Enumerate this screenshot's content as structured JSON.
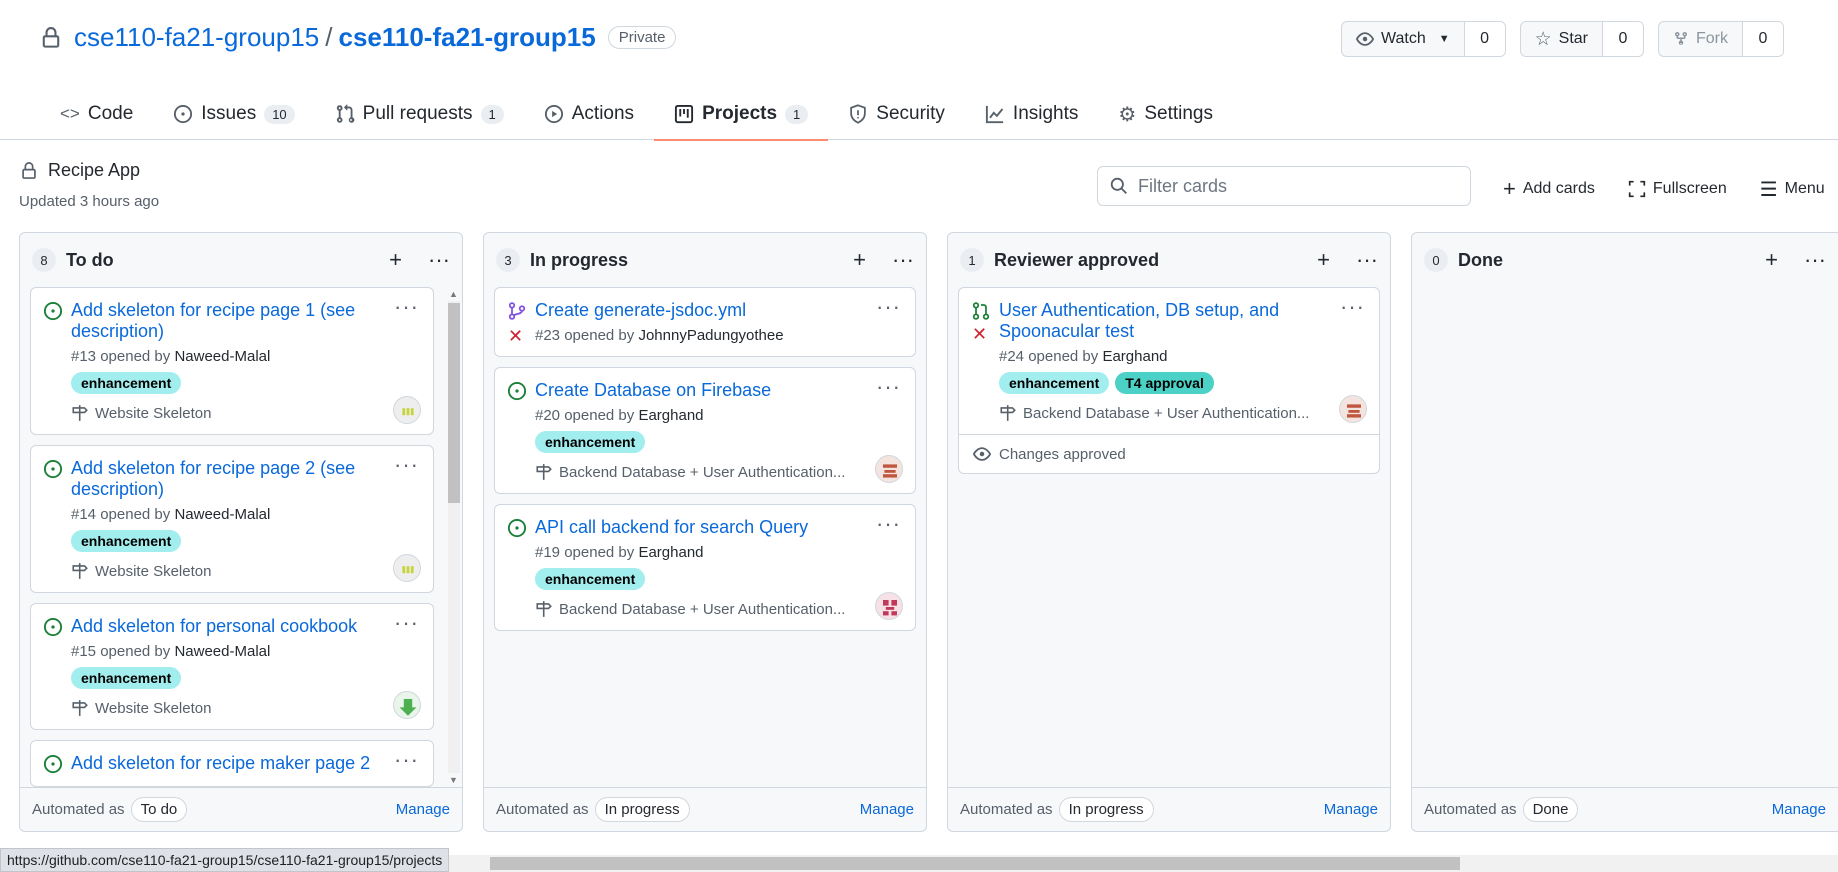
{
  "repo": {
    "owner": "cse110-fa21-group15",
    "separator": "/",
    "name": "cse110-fa21-group15",
    "visibility": "Private"
  },
  "actions": {
    "watch_label": "Watch",
    "watch_count": "0",
    "star_label": "Star",
    "star_count": "0",
    "fork_label": "Fork",
    "fork_count": "0"
  },
  "tabs": [
    {
      "label": "Code",
      "counter": ""
    },
    {
      "label": "Issues",
      "counter": "10"
    },
    {
      "label": "Pull requests",
      "counter": "1"
    },
    {
      "label": "Actions",
      "counter": ""
    },
    {
      "label": "Projects",
      "counter": "1"
    },
    {
      "label": "Security",
      "counter": ""
    },
    {
      "label": "Insights",
      "counter": ""
    },
    {
      "label": "Settings",
      "counter": ""
    }
  ],
  "project": {
    "name": "Recipe App",
    "updated": "Updated 3 hours ago",
    "filter_placeholder": "Filter cards",
    "add_cards": "Add cards",
    "fullscreen": "Fullscreen",
    "menu": "Menu"
  },
  "footer": {
    "automated_as": "Automated as",
    "manage": "Manage"
  },
  "columns": [
    {
      "count": "8",
      "name": "To do",
      "automation": "To do",
      "cards": [
        {
          "title": "Add skeleton for recipe page 1 (see description)",
          "number": "#13",
          "opened_by": "opened by",
          "author": "Naweed-Malal",
          "label": "enhancement",
          "milestone": "Website Skeleton"
        },
        {
          "title": "Add skeleton for recipe page 2 (see description)",
          "number": "#14",
          "opened_by": "opened by",
          "author": "Naweed-Malal",
          "label": "enhancement",
          "milestone": "Website Skeleton"
        },
        {
          "title": "Add skeleton for personal cookbook",
          "number": "#15",
          "opened_by": "opened by",
          "author": "Naweed-Malal",
          "label": "enhancement",
          "milestone": "Website Skeleton"
        },
        {
          "title": "Add skeleton for recipe maker page 2"
        }
      ]
    },
    {
      "count": "3",
      "name": "In progress",
      "automation": "In progress",
      "cards": [
        {
          "title": "Create generate-jsdoc.yml",
          "number": "#23",
          "opened_by": "opened by",
          "author": "JohnnyPadungyothee"
        },
        {
          "title": "Create Database on Firebase",
          "number": "#20",
          "opened_by": "opened by",
          "author": "Earghand",
          "label": "enhancement",
          "milestone": "Backend Database + User Authentication..."
        },
        {
          "title": "API call backend for search Query",
          "number": "#19",
          "opened_by": "opened by",
          "author": "Earghand",
          "label": "enhancement",
          "milestone": "Backend Database + User Authentication..."
        }
      ]
    },
    {
      "count": "1",
      "name": "Reviewer approved",
      "automation": "In progress",
      "cards": [
        {
          "title": "User Authentication, DB setup, and Spoonacular test",
          "number": "#24",
          "opened_by": "opened by",
          "author": "Earghand",
          "label": "enhancement",
          "label2": "T4 approval",
          "milestone": "Backend Database + User Authentication...",
          "review": "Changes approved"
        }
      ]
    },
    {
      "count": "0",
      "name": "Done",
      "automation": "Done",
      "cards": []
    }
  ],
  "status_url": "https://github.com/cse110-fa21-group15/cse110-fa21-group15/projects",
  "colors": {
    "link": "#0969da",
    "open_issue": "#1a7f37",
    "draft_pr": "#8250df",
    "failed": "#cf222e",
    "enhancement_label": "#a2eeef",
    "t4_label": "#4cd1c6",
    "selected_tab_underline": "#fd8c73"
  }
}
